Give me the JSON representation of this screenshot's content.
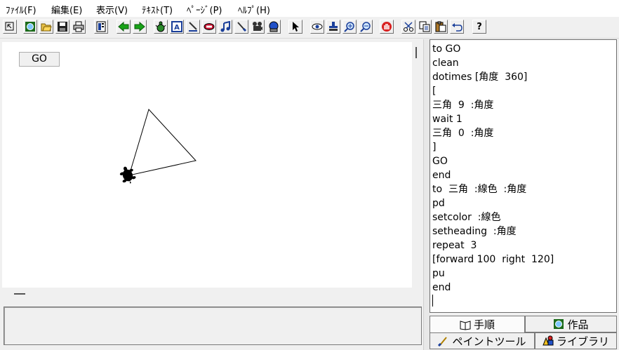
{
  "menu": {
    "items": [
      {
        "label": "ﾌｧｲﾙ(F)"
      },
      {
        "label": "編集(E)"
      },
      {
        "label": "表示(V)"
      },
      {
        "label": "ﾃｷｽﾄ(T)"
      },
      {
        "label": "ﾍﾟｰｼﾞ(P)"
      },
      {
        "label": "ﾍﾙﾌﾟ(H)"
      }
    ]
  },
  "toolbar": {
    "icons": [
      "cursor-return-icon",
      "new-page-icon",
      "open-folder-icon",
      "save-icon",
      "print-icon",
      "project-icon",
      "arrow-left-icon",
      "arrow-right-icon",
      "new-turtle-icon",
      "text-box-icon",
      "pen-icon",
      "button-icon",
      "music-icon",
      "brush-icon",
      "movie-icon",
      "stamp-icon",
      "pointer-icon",
      "eye-icon",
      "stamp2-icon",
      "zoom-in-icon",
      "zoom-out-icon",
      "stop-icon",
      "cut-icon",
      "copy-icon",
      "paste-icon",
      "undo-icon",
      "help-icon"
    ],
    "help_label": "?"
  },
  "canvas": {
    "go_button_label": "GO"
  },
  "code": {
    "lines": [
      "to GO",
      "clean",
      "dotimes [角度  360]",
      "[",
      "三角  9  :角度",
      "wait 1",
      "三角  0  :角度",
      "]",
      "GO",
      "end",
      "to  三角  :線色  :角度",
      "pd",
      "setcolor  :線色",
      "setheading  :角度",
      "repeat  3",
      "[forward 100  right  120]",
      "pu",
      "end"
    ]
  },
  "tabs": {
    "procedure": "手順",
    "works": "作品",
    "paint_tool": "ペイントツール",
    "library": "ライブラリ"
  },
  "colors": {
    "canvas_bg": "#ffffff",
    "window_bg": "#f0f0f0",
    "turtle": "#000000"
  }
}
